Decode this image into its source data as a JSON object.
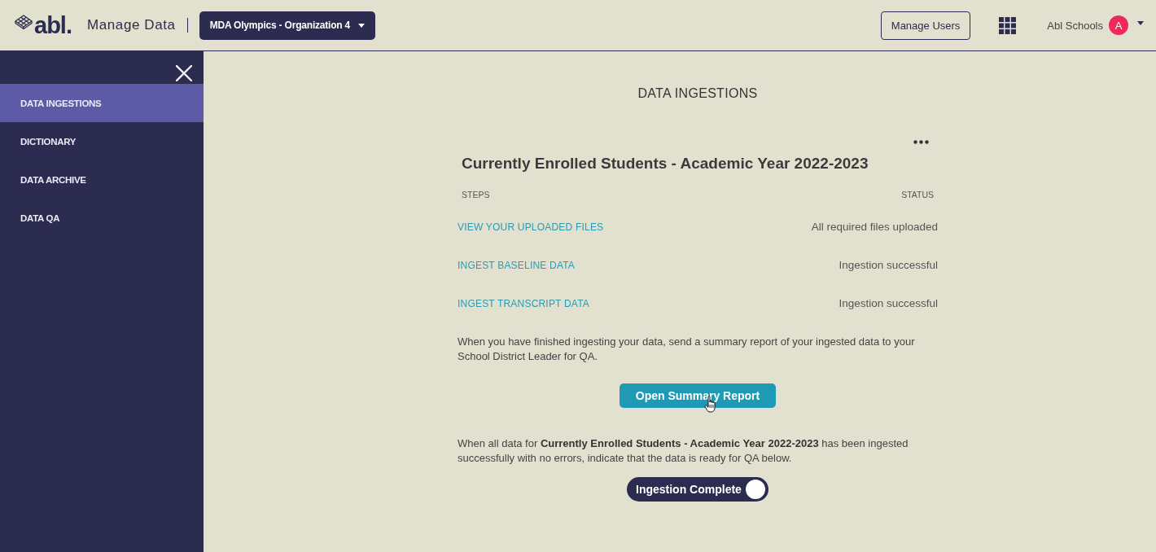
{
  "header": {
    "logo_text": "abl.",
    "app_title": "Manage Data",
    "org_selector": "MDA Olympics - Organization 4",
    "manage_users_button": "Manage Users",
    "account_name": "Abl Schools",
    "avatar_initial": "A"
  },
  "sidebar": {
    "items": [
      {
        "label": "DATA INGESTIONS",
        "selected": true
      },
      {
        "label": "DICTIONARY",
        "selected": false
      },
      {
        "label": "DATA ARCHIVE",
        "selected": false
      },
      {
        "label": "DATA QA",
        "selected": false
      }
    ]
  },
  "page_title": "DATA INGESTIONS",
  "ingestion_card": {
    "title": "Currently Enrolled Students - Academic Year 2022-2023",
    "columns": [
      "STEPS",
      "STATUS"
    ],
    "steps": [
      {
        "step": "VIEW YOUR UPLOADED FILES",
        "status": "All required files uploaded"
      },
      {
        "step": "INGEST BASELINE DATA",
        "status": "Ingestion successful"
      },
      {
        "step": "INGEST TRANSCRIPT DATA",
        "status": "Ingestion successful"
      }
    ],
    "summary_instructions": "When you have finished ingesting your data, send a summary report of your ingested data to your School District Leader for QA.",
    "summary_button": "Open Summary Report",
    "qa_instructions": "When all data for **Currently Enrolled Students - Academic Year 2022-2023** has been ingested successfully with no errors, indicate that the data is ready for QA below.",
    "completion_toggle": {
      "label": "Ingestion Complete",
      "on": true
    }
  }
}
